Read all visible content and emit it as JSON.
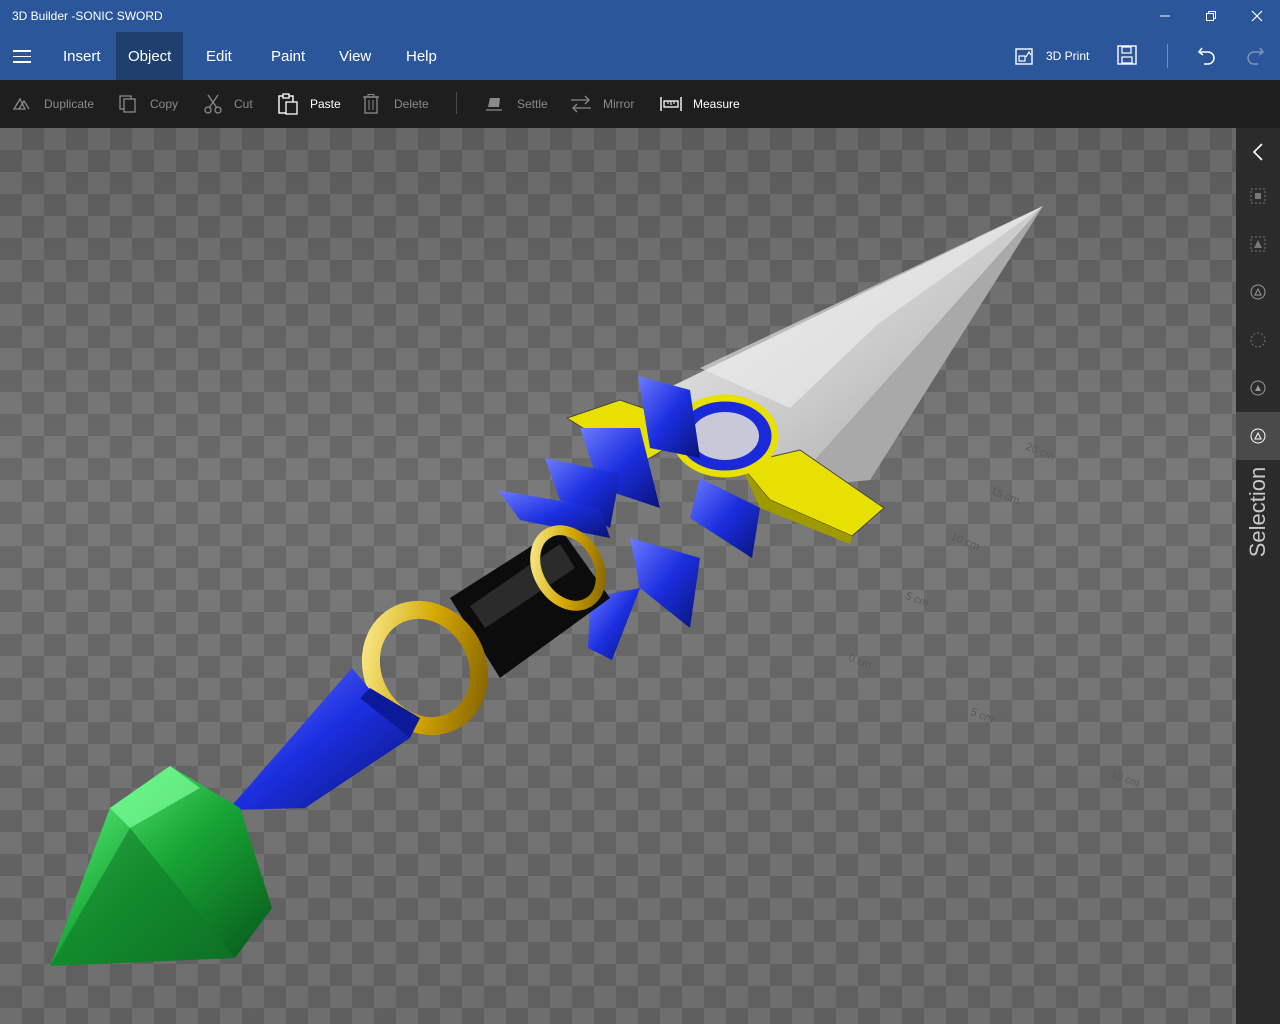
{
  "window": {
    "title": "3D Builder -SONIC SWORD"
  },
  "menu": {
    "items": [
      {
        "label": "Insert"
      },
      {
        "label": "Object"
      },
      {
        "label": "Edit"
      },
      {
        "label": "Paint"
      },
      {
        "label": "View"
      },
      {
        "label": "Help"
      }
    ],
    "active": "Object",
    "print_label": "3D Print"
  },
  "toolbar": {
    "tools": [
      {
        "label": "Duplicate",
        "enabled": false,
        "icon": "duplicate-icon"
      },
      {
        "label": "Copy",
        "enabled": false,
        "icon": "copy-icon"
      },
      {
        "label": "Cut",
        "enabled": false,
        "icon": "cut-icon"
      },
      {
        "label": "Paste",
        "enabled": true,
        "icon": "paste-icon"
      },
      {
        "label": "Delete",
        "enabled": false,
        "icon": "delete-icon"
      },
      {
        "label": "Settle",
        "enabled": false,
        "icon": "settle-icon"
      },
      {
        "label": "Mirror",
        "enabled": false,
        "icon": "mirror-icon"
      },
      {
        "label": "Measure",
        "enabled": true,
        "icon": "measure-icon"
      }
    ]
  },
  "side_panel": {
    "label": "Selection",
    "buttons": [
      "collapse-icon",
      "select-objects-icon",
      "select-faces-icon",
      "select-edges-icon",
      "select-lasso-icon",
      "select-vertex-icon",
      "select-shape-icon"
    ]
  },
  "ruler": {
    "labels": [
      "20 cm",
      "15 cm",
      "10 cm",
      "5 cm",
      "0 cm",
      "5 cm",
      "10 cm"
    ]
  },
  "colors": {
    "accent": "#2b579a",
    "toolbar_bg": "#1e1e1e",
    "side_bg": "#2b2b2b",
    "blade": "#d8d8d8",
    "guard_yellow": "#e8e000",
    "hilt_blue": "#1a2ad8",
    "ring_gold": "#d4a800",
    "pommel_green": "#1bb33a"
  }
}
